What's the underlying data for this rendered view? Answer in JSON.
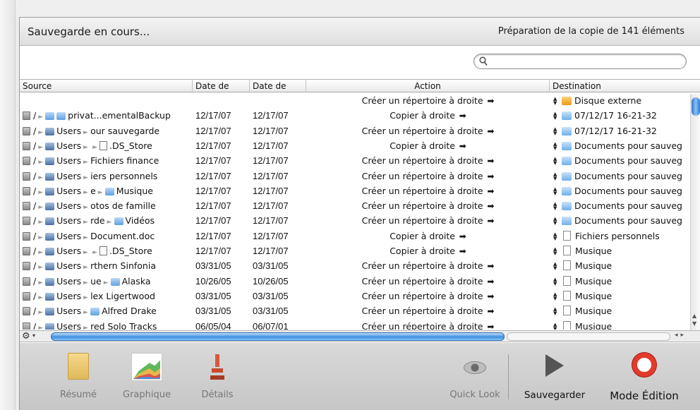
{
  "status": {
    "left_text": "Sauvegarde en cours...",
    "right_text": "Préparation de la copie de 141 éléments"
  },
  "search": {
    "placeholder": ""
  },
  "table": {
    "columns": [
      "Source",
      "Date de",
      "Date de",
      "Action",
      "Destination"
    ],
    "rows": [
      {
        "source_parts": [],
        "date1": "",
        "date2": "",
        "action": "Créer un répertoire à droite",
        "dest": "Disque externe",
        "dest_icon": "external-disk-icon"
      },
      {
        "source_parts": [
          "/",
          "privat...ementalBackup"
        ],
        "date1": "12/17/07",
        "date2": "12/17/07",
        "action": "Copier à droite",
        "dest": "07/12/17 16-21-32",
        "dest_icon": "folder-icon"
      },
      {
        "source_parts": [
          "/",
          "Users",
          "our sauvegarde"
        ],
        "date1": "12/17/07",
        "date2": "12/17/07",
        "action": "Créer un répertoire à droite",
        "dest": "07/12/17 16-21-32",
        "dest_icon": "folder-icon"
      },
      {
        "source_parts": [
          "/",
          "Users",
          "",
          ".DS_Store"
        ],
        "date1": "12/17/07",
        "date2": "12/17/07",
        "action": "Copier à droite",
        "dest": "Documents pour sauveg",
        "dest_icon": "folder-icon"
      },
      {
        "source_parts": [
          "/",
          "Users",
          "Fichiers finance"
        ],
        "date1": "12/17/07",
        "date2": "12/17/07",
        "action": "Créer un répertoire à droite",
        "dest": "Documents pour sauveg",
        "dest_icon": "folder-icon"
      },
      {
        "source_parts": [
          "/",
          "Users",
          "iers personnels"
        ],
        "date1": "12/17/07",
        "date2": "12/17/07",
        "action": "Créer un répertoire à droite",
        "dest": "Documents pour sauveg",
        "dest_icon": "folder-icon"
      },
      {
        "source_parts": [
          "/",
          "Users",
          "e",
          "Musique"
        ],
        "date1": "12/17/07",
        "date2": "12/17/07",
        "action": "Créer un répertoire à droite",
        "dest": "Documents pour sauveg",
        "dest_icon": "folder-icon"
      },
      {
        "source_parts": [
          "/",
          "Users",
          "otos de famille"
        ],
        "date1": "12/17/07",
        "date2": "12/17/07",
        "action": "Créer un répertoire à droite",
        "dest": "Documents pour sauveg",
        "dest_icon": "folder-icon"
      },
      {
        "source_parts": [
          "/",
          "Users",
          "rde",
          "Vidéos"
        ],
        "date1": "12/17/07",
        "date2": "12/17/07",
        "action": "Créer un répertoire à droite",
        "dest": "Documents pour sauveg",
        "dest_icon": "folder-icon"
      },
      {
        "source_parts": [
          "/",
          "Users",
          "Document.doc"
        ],
        "date1": "12/17/07",
        "date2": "12/17/07",
        "action": "Copier à droite",
        "dest": "Fichiers personnels",
        "dest_icon": "document-icon"
      },
      {
        "source_parts": [
          "/",
          "Users",
          "",
          ".DS_Store"
        ],
        "date1": "12/17/07",
        "date2": "12/17/07",
        "action": "Copier à droite",
        "dest": "Musique",
        "dest_icon": "document-icon"
      },
      {
        "source_parts": [
          "/",
          "Users",
          "rthern Sinfonia"
        ],
        "date1": "03/31/05",
        "date2": "03/31/05",
        "action": "Créer un répertoire à droite",
        "dest": "Musique",
        "dest_icon": "document-icon"
      },
      {
        "source_parts": [
          "/",
          "Users",
          "ue",
          "Alaska"
        ],
        "date1": "10/26/05",
        "date2": "10/26/05",
        "action": "Créer un répertoire à droite",
        "dest": "Musique",
        "dest_icon": "document-icon"
      },
      {
        "source_parts": [
          "/",
          "Users",
          "lex Ligertwood"
        ],
        "date1": "03/31/05",
        "date2": "03/31/05",
        "action": "Créer un répertoire à droite",
        "dest": "Musique",
        "dest_icon": "document-icon"
      },
      {
        "source_parts": [
          "/",
          "Users",
          "Alfred Drake"
        ],
        "date1": "03/31/05",
        "date2": "03/31/05",
        "action": "Créer un répertoire à droite",
        "dest": "Musique",
        "dest_icon": "document-icon"
      },
      {
        "source_parts": [
          "/",
          "Users",
          "red Solo Tracks"
        ],
        "date1": "06/05/04",
        "date2": "06/07/01",
        "action": "Créer un répertoire à droite",
        "dest": "Musique",
        "dest_icon": "document-icon"
      }
    ]
  },
  "progress": {
    "fraction": 0.0
  },
  "toolbar": {
    "resume": "Résumé",
    "graphique": "Graphique",
    "details": "Détails",
    "quicklook": "Quick Look",
    "sauvegarder": "Sauvegarder",
    "mode_edition": "Mode Édition"
  }
}
